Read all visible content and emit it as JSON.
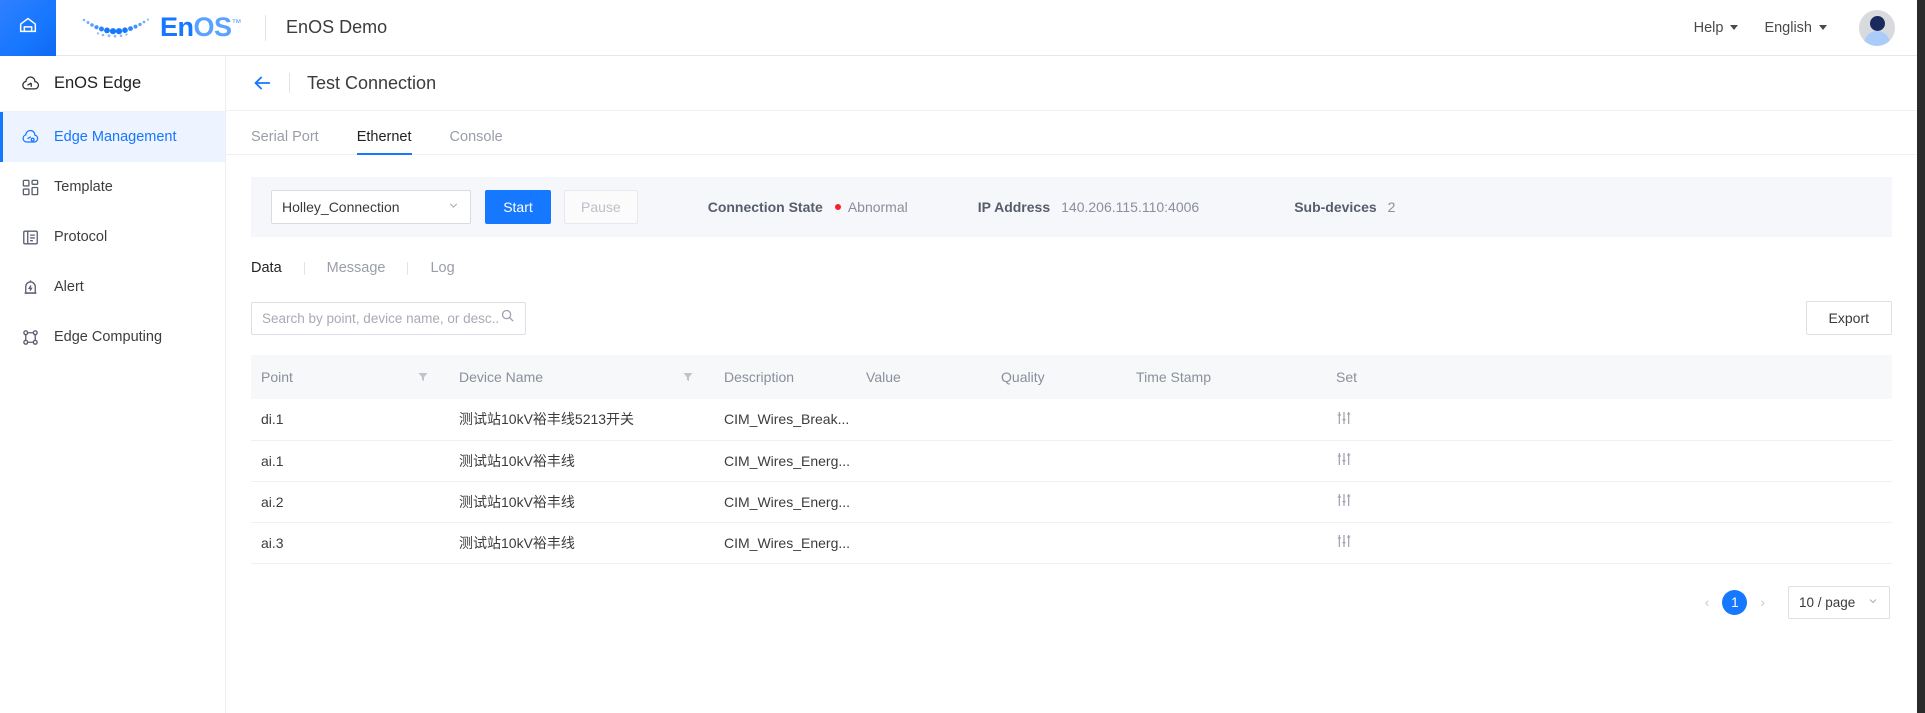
{
  "topbar": {
    "home_icon": "home-icon",
    "brand": {
      "en": "En",
      "o": "O",
      "s": "S",
      "tm": "™"
    },
    "app_title": "EnOS Demo",
    "help_label": "Help",
    "language_label": "English",
    "avatar_alt": "user-avatar"
  },
  "sidebar": {
    "header": "EnOS Edge",
    "items": [
      {
        "label": "Edge Management",
        "icon": "edge-cloud-icon",
        "active": true
      },
      {
        "label": "Template",
        "icon": "template-grid-icon",
        "active": false
      },
      {
        "label": "Protocol",
        "icon": "protocol-list-icon",
        "active": false
      },
      {
        "label": "Alert",
        "icon": "alert-bell-icon",
        "active": false
      },
      {
        "label": "Edge Computing",
        "icon": "edge-computing-nodes-icon",
        "active": false
      }
    ]
  },
  "page": {
    "back_icon": "back-arrow-icon",
    "title": "Test Connection",
    "tabs": [
      {
        "label": "Serial Port",
        "active": false
      },
      {
        "label": "Ethernet",
        "active": true
      },
      {
        "label": "Console",
        "active": false
      }
    ]
  },
  "connection": {
    "selected_connection": "Holley_Connection",
    "start_label": "Start",
    "pause_label": "Pause",
    "state_label": "Connection State",
    "state_value": "Abnormal",
    "state_color": "#f5222d",
    "ip_label": "IP Address",
    "ip_value": "140.206.115.110:4006",
    "subdevices_label": "Sub-devices",
    "subdevices_value": "2"
  },
  "subtabs": [
    {
      "label": "Data",
      "active": true
    },
    {
      "label": "Message",
      "active": false
    },
    {
      "label": "Log",
      "active": false
    }
  ],
  "toolbar": {
    "search_placeholder": "Search by point, device name, or desc...",
    "search_value": "",
    "search_icon": "search-icon",
    "export_label": "Export"
  },
  "table": {
    "columns": [
      {
        "label": "Point",
        "filter": true
      },
      {
        "label": "Device Name",
        "filter": true
      },
      {
        "label": "Description",
        "filter": false
      },
      {
        "label": "Value",
        "filter": false
      },
      {
        "label": "Quality",
        "filter": false
      },
      {
        "label": "Time Stamp",
        "filter": false
      },
      {
        "label": "Set",
        "filter": false
      }
    ],
    "rows": [
      {
        "point": "di.1",
        "device_name": "测试站10kV裕丰线5213开关",
        "description": "CIM_Wires_Break...",
        "value": "",
        "quality": "",
        "time_stamp": "",
        "set_icon": "sliders-icon"
      },
      {
        "point": "ai.1",
        "device_name": "测试站10kV裕丰线",
        "description": "CIM_Wires_Energ...",
        "value": "",
        "quality": "",
        "time_stamp": "",
        "set_icon": "sliders-icon"
      },
      {
        "point": "ai.2",
        "device_name": "测试站10kV裕丰线",
        "description": "CIM_Wires_Energ...",
        "value": "",
        "quality": "",
        "time_stamp": "",
        "set_icon": "sliders-icon"
      },
      {
        "point": "ai.3",
        "device_name": "测试站10kV裕丰线",
        "description": "CIM_Wires_Energ...",
        "value": "",
        "quality": "",
        "time_stamp": "",
        "set_icon": "sliders-icon"
      }
    ]
  },
  "pagination": {
    "prev_icon": "chevron-left-icon",
    "next_icon": "chevron-right-icon",
    "current_page": "1",
    "page_size_label": "10 / page"
  },
  "colors": {
    "accent": "#1677ff",
    "danger": "#f5222d",
    "panel_bg": "#f5f7fa",
    "table_head_bg": "#f7f8fa"
  }
}
